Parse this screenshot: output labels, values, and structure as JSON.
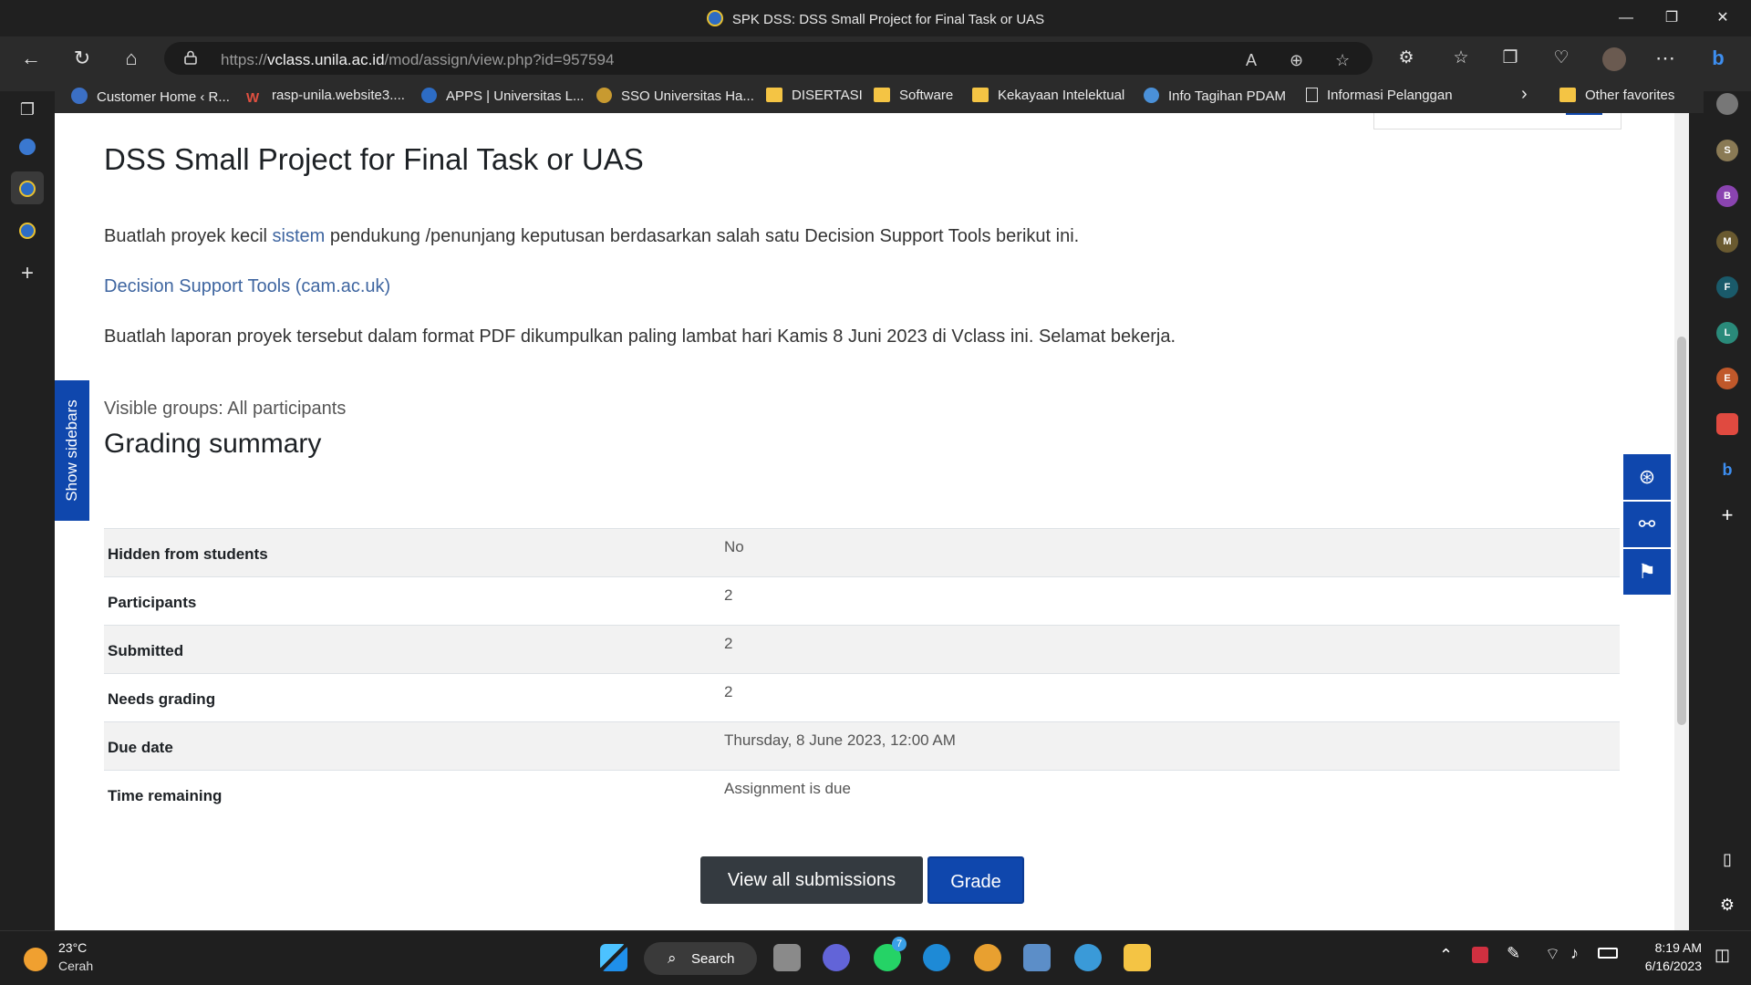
{
  "window": {
    "title": "SPK DSS: DSS Small Project for Final Task or UAS",
    "minimize": "—",
    "restore": "❐",
    "close": "✕"
  },
  "toolbar": {
    "back": "←",
    "refresh": "↻",
    "home": "⌂",
    "url_prefix": "https://",
    "url_host": "vclass.unila.ac.id",
    "url_path": "/mod/assign/view.php?id=957594",
    "icons": [
      "read-aloud-icon",
      "zoom-icon",
      "favorite-star-icon",
      "extensions-icon",
      "favorites-icon",
      "collections-icon",
      "performance-icon",
      "profile-icon",
      "more-icon"
    ]
  },
  "favorites": [
    {
      "label": "Customer Home ‹ R...",
      "icon": "wordpress-icon"
    },
    {
      "label": "rasp-unila.website3....",
      "icon": "w-icon"
    },
    {
      "label": "APPS | Universitas L...",
      "icon": "unila-icon"
    },
    {
      "label": "SSO Universitas Ha...",
      "icon": "sso-icon"
    },
    {
      "label": "DISERTASI",
      "icon": "folder-icon"
    },
    {
      "label": "Software",
      "icon": "folder-icon"
    },
    {
      "label": "Kekayaan Intelektual",
      "icon": "folder-icon"
    },
    {
      "label": "Info Tagihan PDAM",
      "icon": "pdam-icon"
    },
    {
      "label": "Informasi Pelanggan",
      "icon": "page-icon"
    },
    {
      "label": "Other favorites",
      "icon": "folder-icon"
    }
  ],
  "fav_more": "›",
  "page": {
    "heading": "DSS Small Project for Final Task or UAS",
    "intro_before": "Buatlah proyek kecil ",
    "intro_link": "sistem",
    "intro_after": " pendukung /penunjang keputusan berdasarkan salah satu Decision Support Tools berikut ini.",
    "tools_link": "Decision Support Tools (cam.ac.uk)",
    "instruction": "Buatlah laporan proyek tersebut dalam format PDF dikumpulkan paling lambat hari Kamis 8 Juni 2023 di Vclass ini. Selamat bekerja.",
    "show_sidebars": "Show sidebars",
    "visible_groups": "Visible groups: All participants",
    "grading_title": "Grading summary",
    "rows": [
      {
        "key": "Hidden from students",
        "value": "No"
      },
      {
        "key": "Participants",
        "value": "2"
      },
      {
        "key": "Submitted",
        "value": "2"
      },
      {
        "key": "Needs grading",
        "value": "2"
      },
      {
        "key": "Due date",
        "value": "Thursday, 8 June 2023, 12:00 AM"
      },
      {
        "key": "Time remaining",
        "value": "Assignment is due"
      }
    ],
    "view_all_btn": "View all submissions",
    "grade_btn": "Grade"
  },
  "right_sidebar": {
    "avatars": [
      "S",
      "B",
      "M",
      "F",
      "L",
      "E"
    ],
    "add": "+"
  },
  "colors": {
    "primary": "#0f47ad",
    "dark_button": "#343a40",
    "link": "#3e65a0"
  },
  "taskbar": {
    "temp": "23°C",
    "condition": "Cerah",
    "search": "Search",
    "whatsapp_badge": "7",
    "time": "8:19 AM",
    "date": "6/16/2023"
  }
}
